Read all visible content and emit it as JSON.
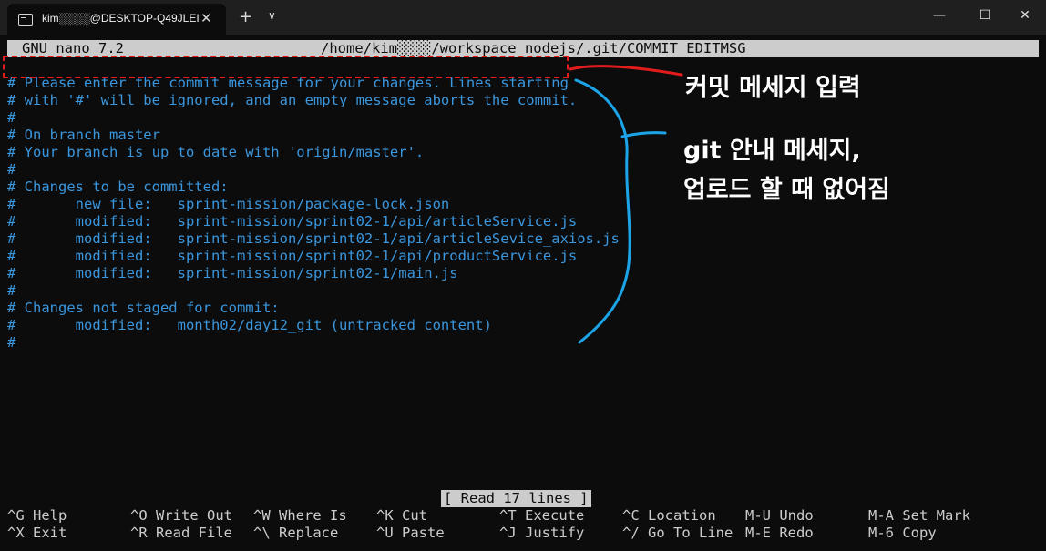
{
  "window": {
    "tab_title": "kim░░░░@DESKTOP-Q49JLEI",
    "tab_close": "✕",
    "new_tab": "+",
    "tab_dropdown": "∨",
    "minimize": "—",
    "maximize": "☐",
    "close": "✕"
  },
  "nano": {
    "version": "GNU nano 7.2",
    "file_path": "/home/kim░░░░/workspace_nodejs/.git/COMMIT_EDITMSG",
    "status": "[ Read 17 lines ]",
    "lines": [
      "# Please enter the commit message for your changes. Lines starting",
      "# with '#' will be ignored, and an empty message aborts the commit.",
      "#",
      "# On branch master",
      "# Your branch is up to date with 'origin/master'.",
      "#",
      "# Changes to be committed:",
      "#       new file:   sprint-mission/package-lock.json",
      "#       modified:   sprint-mission/sprint02-1/api/articleService.js",
      "#       modified:   sprint-mission/sprint02-1/api/articleSevice_axios.js",
      "#       modified:   sprint-mission/sprint02-1/api/productService.js",
      "#       modified:   sprint-mission/sprint02-1/main.js",
      "#",
      "# Changes not staged for commit:",
      "#       modified:   month02/day12_git (untracked content)",
      "#"
    ],
    "shortcuts": [
      {
        "key": "^G",
        "label": "Help"
      },
      {
        "key": "^X",
        "label": "Exit"
      },
      {
        "key": "^O",
        "label": "Write Out"
      },
      {
        "key": "^R",
        "label": "Read File"
      },
      {
        "key": "^W",
        "label": "Where Is"
      },
      {
        "key": "^\\",
        "label": "Replace"
      },
      {
        "key": "^K",
        "label": "Cut"
      },
      {
        "key": "^U",
        "label": "Paste"
      },
      {
        "key": "^T",
        "label": "Execute"
      },
      {
        "key": "^J",
        "label": "Justify"
      },
      {
        "key": "^C",
        "label": "Location"
      },
      {
        "key": "^/",
        "label": "Go To Line"
      },
      {
        "key": "M-U",
        "label": "Undo"
      },
      {
        "key": "M-E",
        "label": "Redo"
      },
      {
        "key": "M-A",
        "label": "Set Mark"
      },
      {
        "key": "M-6",
        "label": "Copy"
      }
    ]
  },
  "annotations": {
    "commit_message_label": "커밋 메세지 입력",
    "git_guide_line1": "git 안내 메세지,",
    "git_guide_line2": "업로드 할 때 없어짐",
    "red_color": "#e21b1b",
    "blue_color": "#1ba5e8"
  },
  "colors": {
    "terminal_bg": "#0c0c0c",
    "comment_text": "#3a96dd",
    "bar_bg": "#cccccc"
  }
}
